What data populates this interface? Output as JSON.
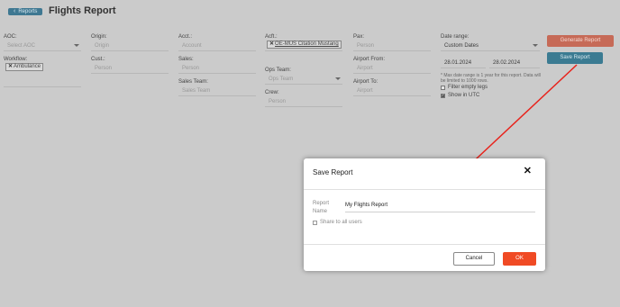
{
  "header": {
    "back_label": "Reports",
    "title": "Flights Report"
  },
  "filters": {
    "aoc": {
      "label": "AOC:",
      "placeholder": "Select AOC"
    },
    "workflow": {
      "label": "Workflow:",
      "chip": "Ambulance"
    },
    "origin": {
      "label": "Origin:",
      "placeholder": "Origin"
    },
    "cust": {
      "label": "Cust.:",
      "placeholder": "Person"
    },
    "acct": {
      "label": "Acct.:",
      "placeholder": "Account"
    },
    "sales": {
      "label": "Sales:",
      "placeholder": "Person"
    },
    "sales_team": {
      "label": "Sales Team:",
      "placeholder": "Sales Team"
    },
    "acft": {
      "label": "Acft.:",
      "chip": "OE-MUS Citation Mustang"
    },
    "ops_team": {
      "label": "Ops Team:",
      "placeholder": "Ops Team"
    },
    "crew": {
      "label": "Crew:",
      "placeholder": "Person"
    },
    "pax": {
      "label": "Pax:",
      "placeholder": "Person"
    },
    "airport_from": {
      "label": "Airport From:",
      "placeholder": "Airport"
    },
    "airport_to": {
      "label": "Airport To:",
      "placeholder": "Airport"
    },
    "date_range": {
      "label": "Date range:",
      "selected": "Custom Dates",
      "start": "28.01.2024",
      "end": "28.02.2024",
      "note": "* Max date range is 1 year for this report. Data will be limited to 1000 rows."
    },
    "filter_empty_legs": {
      "label": "Filter empty legs",
      "checked": false
    },
    "show_in_utc": {
      "label": "Show in UTC",
      "checked": true
    }
  },
  "actions": {
    "generate_label": "Generate Report",
    "save_label": "Save Report",
    "generate_color": "#c66a57",
    "save_color": "#3b7b92"
  },
  "modal": {
    "title": "Save Report",
    "close_icon": "close-icon",
    "name_label": "Report Name",
    "name_value": "My Flights Report",
    "share_label": "Share to all users",
    "share_checked": false,
    "cancel_label": "Cancel",
    "ok_label": "OK",
    "ok_color": "#f04a24"
  },
  "annotation": {
    "arrow_color": "#e8231c"
  }
}
